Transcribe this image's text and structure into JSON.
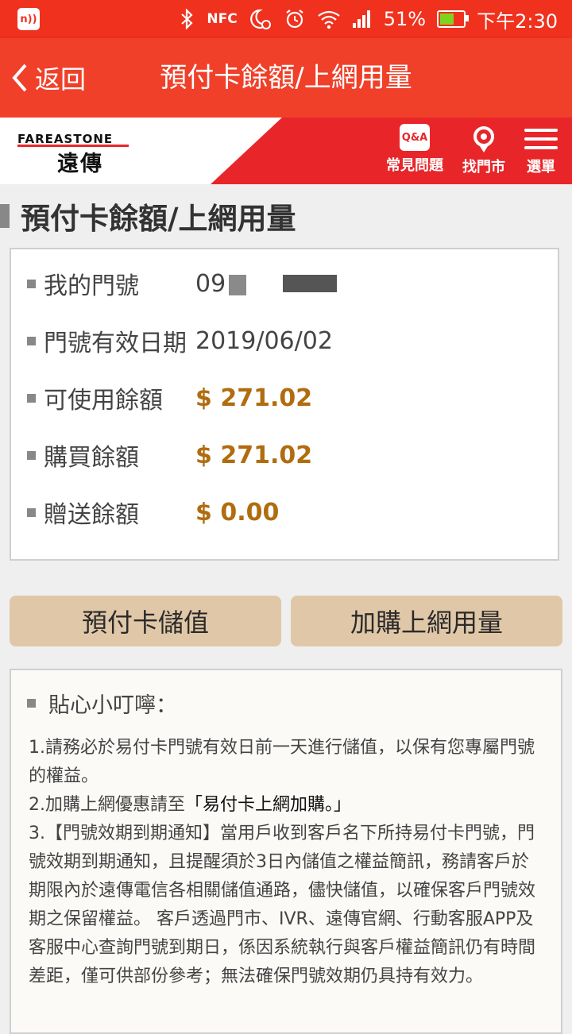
{
  "status_bar": {
    "notification": "n))",
    "nfc": "NFC",
    "battery_pct": "51%",
    "time": "下午2:30"
  },
  "title_bar": {
    "back_label": "返回",
    "title": "預付卡餘額/上網用量"
  },
  "brand": {
    "logo_en": "FAREASTONE",
    "logo_zh": "遠傳",
    "actions": [
      {
        "label": "常見問題",
        "icon": "qa-icon",
        "icon_text": "Q&A"
      },
      {
        "label": "找門市",
        "icon": "store-pin-icon"
      },
      {
        "label": "選單",
        "icon": "menu-icon"
      }
    ]
  },
  "heading": "預付卡餘額/上網用量",
  "info": {
    "rows": [
      {
        "label": "我的門號",
        "value": "09"
      },
      {
        "label": "門號有效日期",
        "value": "2019/06/02"
      },
      {
        "label": "可使用餘額",
        "value": "$ 271.02"
      },
      {
        "label": "購買餘額",
        "value": "$ 271.02"
      },
      {
        "label": "贈送餘額",
        "value": "$ 0.00"
      }
    ]
  },
  "buttons": {
    "topup": "預付卡儲值",
    "add_data": "加購上網用量"
  },
  "tips": {
    "title": "貼心小叮嚀：",
    "item1": "1.請務必於易付卡門號有效日前一天進行儲值，以保有您專屬門號的權益。",
    "item2_prefix": "2.加購上網優惠請至",
    "item2_link": "「易付卡上網加購。」",
    "item3": "3.【門號效期到期通知】當用戶收到客戶名下所持易付卡門號，門號效期到期通知，且提醒須於3日內儲值之權益簡訊，務請客戶於期限內於遠傳電信各相關儲值通路，儘快儲值，以確保客戶門號效期之保留權益。 客戶透過門市、IVR、遠傳官網、行動客服APP及客服中心查詢門號到期日，係因系統執行與客戶權益簡訊仍有時間差距，僅可供部份參考；無法確保門號效期仍具持有效力。"
  },
  "colors": {
    "title_bar": "#f0402a",
    "brand_red": "#e8262a",
    "money": "#b06c0f",
    "button_bg": "#e0c7a7"
  }
}
